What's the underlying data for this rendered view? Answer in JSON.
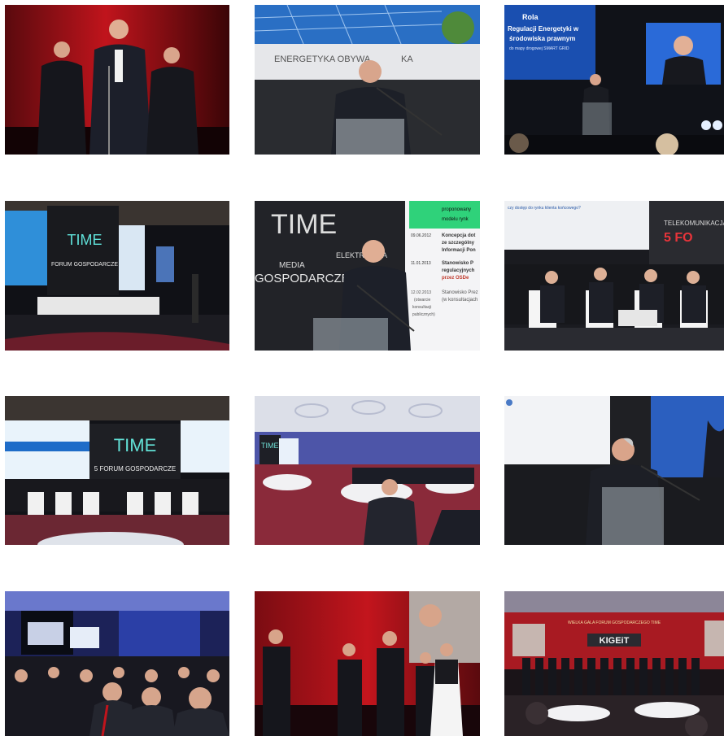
{
  "gallery": {
    "photos": [
      {
        "row": 0,
        "col": 0,
        "overlay_text": []
      },
      {
        "row": 0,
        "col": 1,
        "overlay_text": [
          "ENERGETYKA OBYWA",
          "KA"
        ]
      },
      {
        "row": 0,
        "col": 2,
        "overlay_text": [
          "Rola",
          "Regulacji Energetyki w",
          "środowiska prawnym",
          "do mapy drogowej SMART GRID"
        ]
      },
      {
        "row": 1,
        "col": 0,
        "overlay_text": [
          "TIME",
          "FORUM GOSPODARCZE"
        ]
      },
      {
        "row": 1,
        "col": 1,
        "overlay_text": [
          "TIME",
          "MEDIA",
          "ELEKTRONIKA",
          "GOSPODARCZE",
          "09.06.2012",
          "Koncepcja dot",
          "ze szczególny",
          "Informacji Pon",
          "11.01.2013",
          "Stanowisko P",
          "regulacyjnych",
          "przez OSDe",
          "12.02.2013",
          "(otwarcie",
          "konsultacji",
          "publicznych)",
          "Stanowisko Prez",
          "(w konsultacjach",
          "proponowany",
          "modelu rynk"
        ]
      },
      {
        "row": 1,
        "col": 2,
        "overlay_text": [
          "TELEKOMUNIKACJA",
          "5 FO",
          "czy dostęp do rynku klienta końcowego?"
        ]
      },
      {
        "row": 2,
        "col": 0,
        "overlay_text": [
          "TIME",
          "5 FORUM GOSPODARCZE"
        ]
      },
      {
        "row": 2,
        "col": 1,
        "overlay_text": [
          "TIME"
        ]
      },
      {
        "row": 2,
        "col": 2,
        "overlay_text": []
      },
      {
        "row": 3,
        "col": 0,
        "overlay_text": []
      },
      {
        "row": 3,
        "col": 1,
        "overlay_text": []
      },
      {
        "row": 3,
        "col": 2,
        "overlay_text": [
          "WIELKA GALA FORUM GOSPODARCZEGO TIME",
          "KIGEiT"
        ]
      }
    ]
  },
  "colors": {
    "stage_red": "#b8121a",
    "dark_stage": "#1a1a1a",
    "screen_blue": "#1f5fd6",
    "suit": "#1b1d24"
  }
}
